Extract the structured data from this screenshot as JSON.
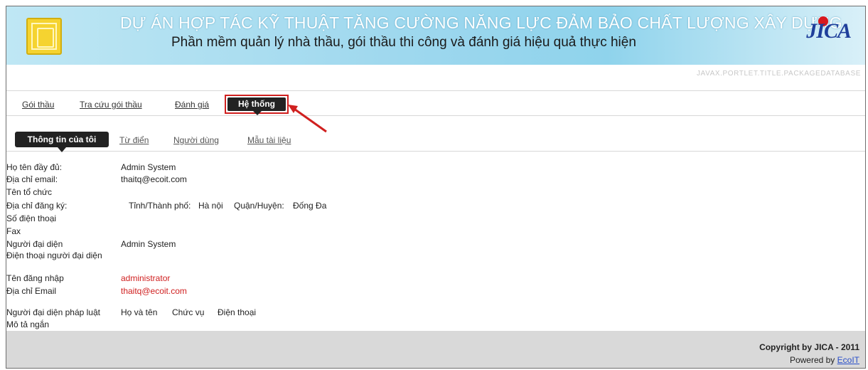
{
  "banner": {
    "title": "DỰ ÁN HỢP TÁC KỸ THUẬT TĂNG CƯỜNG NĂNG LỰC ĐẢM BẢO CHẤT LƯỢNG XÂY DỰNG",
    "subtitle": "Phần mềm quản lý nhà thầu, gói thầu thi công và đánh giá hiệu quả thực hiện",
    "logo_right": "JICA",
    "portlet_title": "JAVAX.PORTLET.TITLE.PACKAGEDATABASE"
  },
  "topnav": {
    "items": [
      "Gói thầu",
      "Tra cứu gói thầu",
      "Đánh giá"
    ],
    "active": "Hệ thống"
  },
  "subnav": {
    "active": "Thông tin của tôi",
    "items": [
      "Từ điển",
      "Người dùng",
      "Mẫu tài liệu"
    ]
  },
  "info": {
    "full_name_label": "Họ tên đầy đủ:",
    "full_name_value": "Admin System",
    "email_label": "Địa chỉ email:",
    "email_value": "thaitq@ecoit.com",
    "org_label": "Tên tổ chức",
    "address_label": "Địa chỉ đăng ký:",
    "province_label": "Tỉnh/Thành phố:",
    "province_value": "Hà nội",
    "district_label": "Quận/Huyện:",
    "district_value": "Đống Đa",
    "phone_label": "Số điện thoại",
    "fax_label": "Fax",
    "rep_label": "Người đại diện",
    "rep_value": "Admin System",
    "rep_phone_label": "Điện thoại người đại diện",
    "login_label": "Tên đăng nhập",
    "login_value": "administrator",
    "email2_label": "Địa chỉ Email",
    "email2_value": "thaitq@ecoit.com",
    "legal_rep_label": "Người đại diện pháp luật",
    "legal_name_label": "Họ và tên",
    "legal_position_label": "Chức vụ",
    "legal_phone_label": "Điện thoại",
    "short_desc_label": "Mô tả ngắn"
  },
  "footer": {
    "copyright": "Copyright by JICA - 2011",
    "powered_prefix": "Powered by",
    "powered_link": "EcoIT"
  },
  "colors": {
    "banner": "#9fd8ee",
    "active_tab": "#222222",
    "highlight_red": "#d0201f",
    "footer": "#d9d9d9"
  }
}
